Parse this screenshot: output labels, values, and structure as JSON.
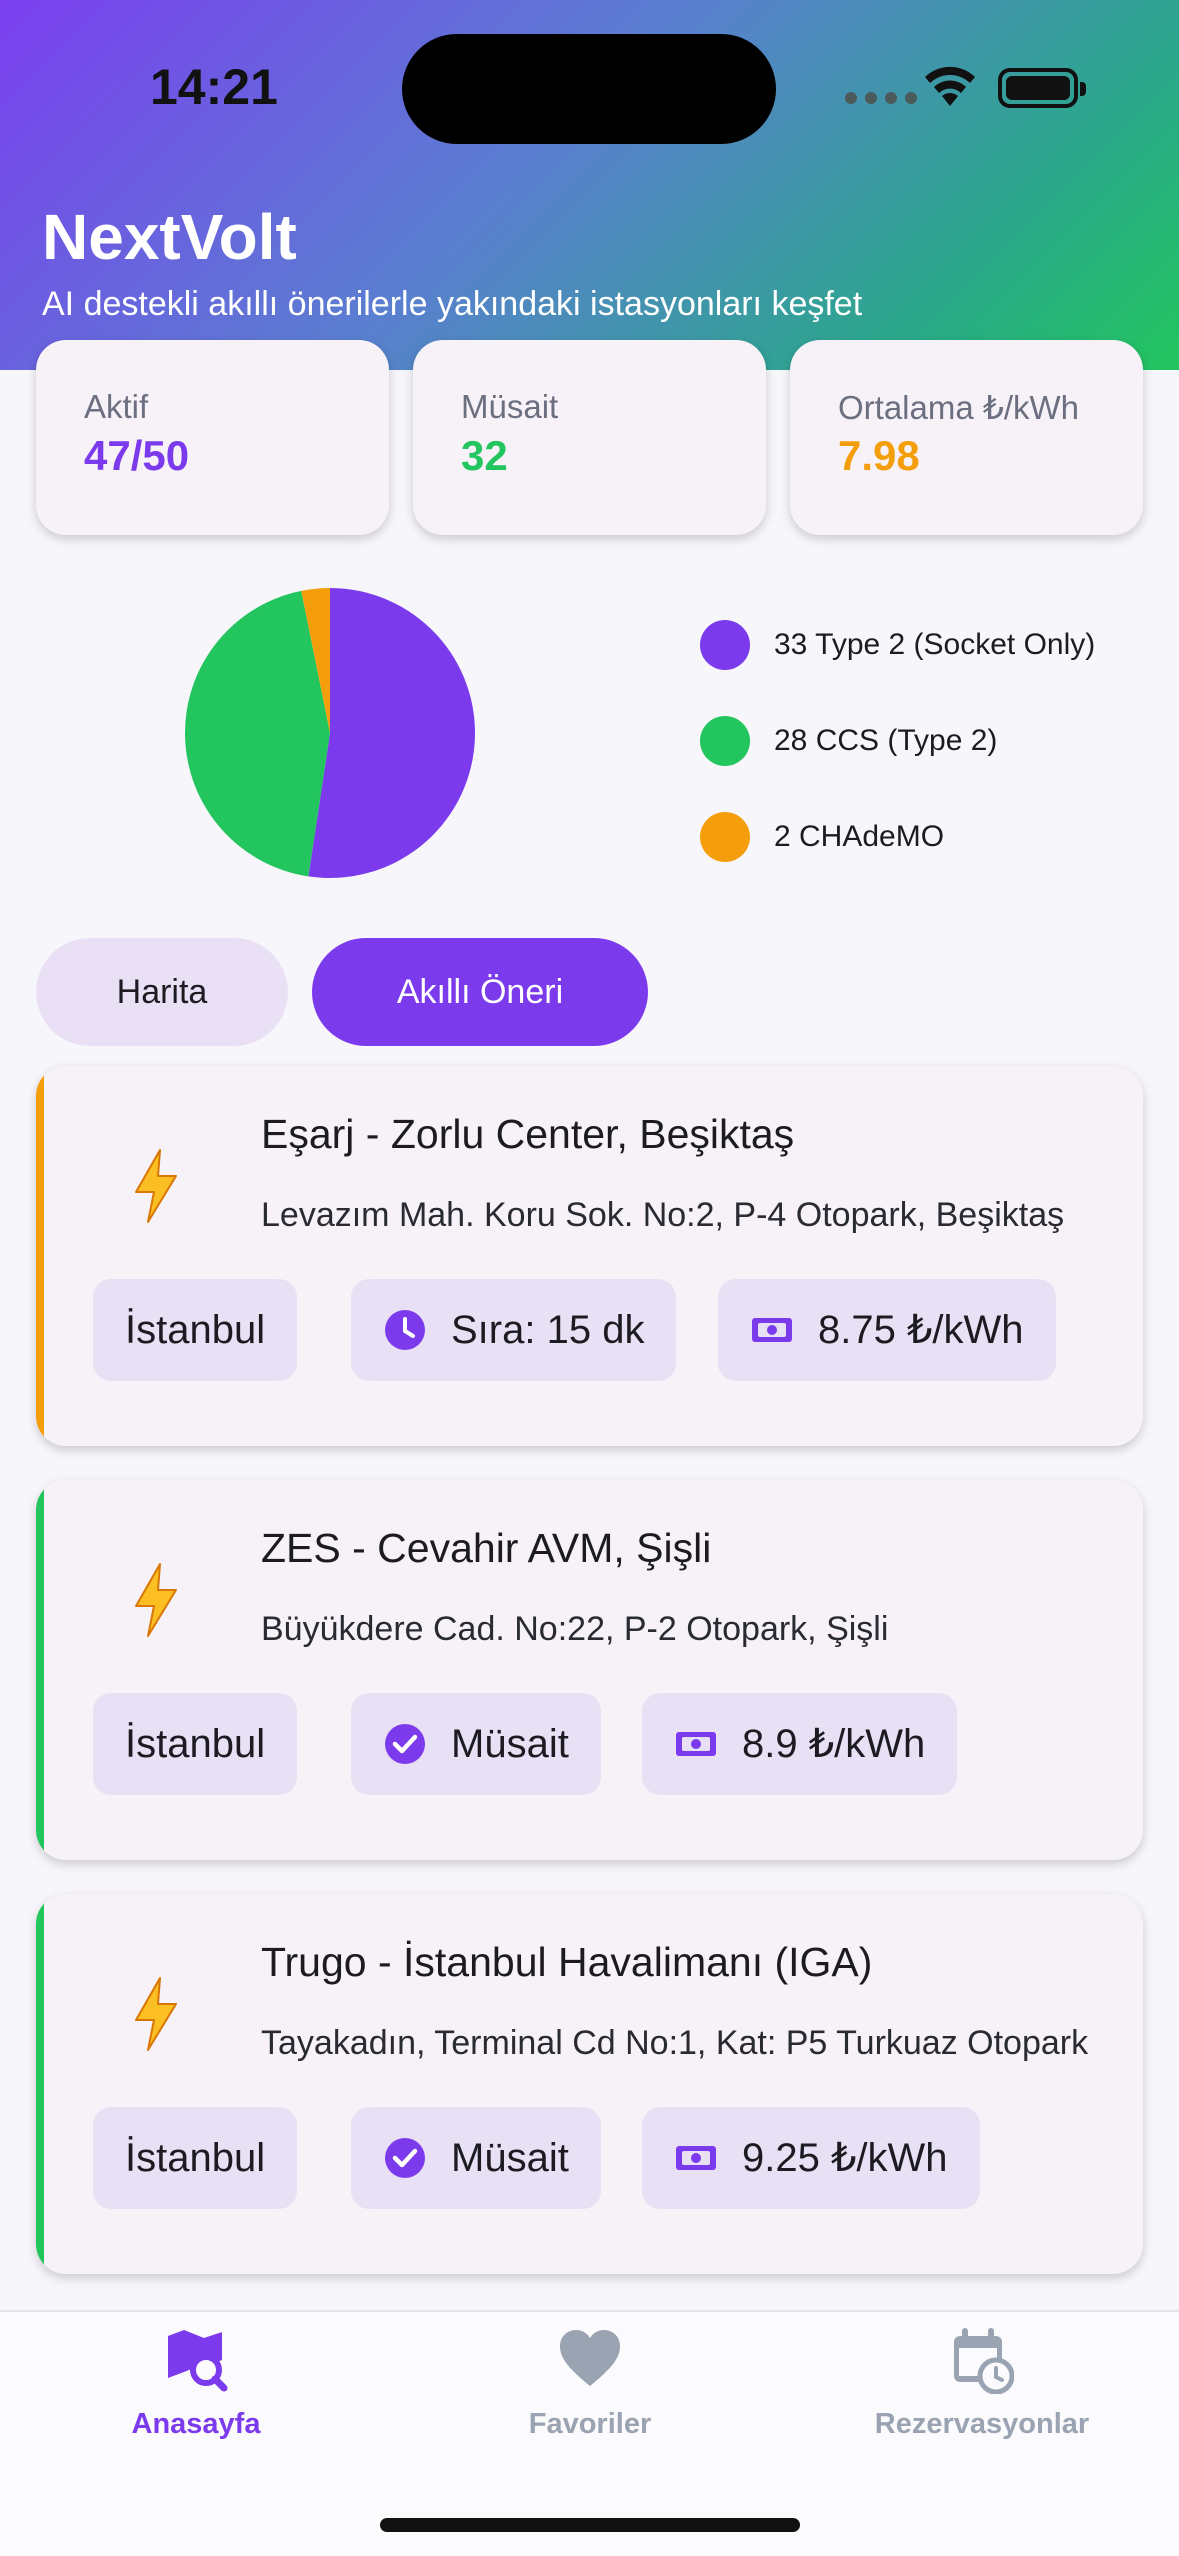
{
  "status_bar": {
    "time": "14:21"
  },
  "header": {
    "title": "NextVolt",
    "subtitle": "AI destekli akıllı önerilerle yakındaki istasyonları keşfet"
  },
  "stats": [
    {
      "label": "Aktif",
      "value": "47/50",
      "color": "#7c3aed"
    },
    {
      "label": "Müsait",
      "value": "32",
      "color": "#22c55e"
    },
    {
      "label": "Ortalama ₺/kWh",
      "value": "7.98",
      "color": "#f59e0b"
    }
  ],
  "chart_data": {
    "type": "pie",
    "categories": [
      "Type 2 (Socket Only)",
      "CCS (Type 2)",
      "CHAdeMO"
    ],
    "values": [
      33,
      28,
      2
    ],
    "colors": [
      "#7c3aed",
      "#22c55e",
      "#f59e0b"
    ],
    "legend_labels": [
      "33 Type 2 (Socket Only)",
      "28 CCS (Type 2)",
      "2 CHAdeMO"
    ],
    "legend_position": "right"
  },
  "tabs": {
    "map": "Harita",
    "smart": "Akıllı Öneri"
  },
  "stations": [
    {
      "name": "Eşarj - Zorlu Center, Beşiktaş",
      "address": "Levazım Mah. Koru Sok. No:2, P-4 Otopark, Beşiktaş",
      "city": "İstanbul",
      "status": "Sıra: 15 dk",
      "status_icon": "clock-icon",
      "price": "8.75 ₺/kWh",
      "accent": "#f59e0b"
    },
    {
      "name": "ZES - Cevahir AVM, Şişli",
      "address": "Büyükdere Cad. No:22, P-2 Otopark, Şişli",
      "city": "İstanbul",
      "status": "Müsait",
      "status_icon": "check-circle-icon",
      "price": "8.9 ₺/kWh",
      "accent": "#22c55e"
    },
    {
      "name": "Trugo - İstanbul Havalimanı (IGA)",
      "address": "Tayakadın, Terminal Cd No:1, Kat: P5 Turkuaz Otopark",
      "city": "İstanbul",
      "status": "Müsait",
      "status_icon": "check-circle-icon",
      "price": "9.25 ₺/kWh",
      "accent": "#22c55e"
    }
  ],
  "nav": [
    {
      "label": "Anasayfa",
      "icon": "map-search-icon",
      "active": true
    },
    {
      "label": "Favoriler",
      "icon": "heart-icon",
      "active": false
    },
    {
      "label": "Rezervasyonlar",
      "icon": "calendar-clock-icon",
      "active": false
    }
  ],
  "colors": {
    "primary": "#7c3aed",
    "inactive": "#9aa3b2"
  }
}
